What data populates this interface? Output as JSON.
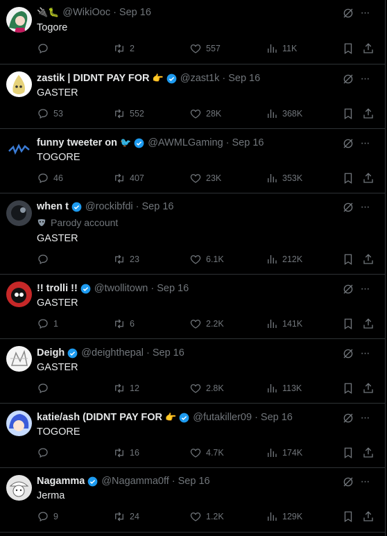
{
  "tweets": [
    {
      "name": "",
      "emoji": "🔌🐛",
      "verified": false,
      "handle": "@WikiOoc",
      "time": "Sep 16",
      "parody": "",
      "text": "Togore",
      "replies": "",
      "retweets": "2",
      "likes": "557",
      "views": "11K"
    },
    {
      "name": "zastik | DIDNT PAY FOR",
      "emoji": "👉",
      "verified": true,
      "handle": "@zast1k",
      "time": "Sep 16",
      "parody": "",
      "text": "GASTER",
      "replies": "53",
      "retweets": "552",
      "likes": "28K",
      "views": "368K"
    },
    {
      "name": "funny tweeter on",
      "emoji": "🐦",
      "verified": true,
      "handle": "@AWMLGaming",
      "time": "Sep 16",
      "parody": "",
      "text": "TOGORE",
      "replies": "46",
      "retweets": "407",
      "likes": "23K",
      "views": "353K"
    },
    {
      "name": "when t",
      "emoji": "",
      "verified": true,
      "handle": "@rockibfdi",
      "time": "Sep 16",
      "parody": "Parody account",
      "text": "GASTER",
      "replies": "",
      "retweets": "23",
      "likes": "6.1K",
      "views": "212K"
    },
    {
      "name": "!! trolli !!",
      "emoji": "",
      "verified": true,
      "handle": "@twollitown",
      "time": "Sep 16",
      "parody": "",
      "text": "GASTER",
      "replies": "1",
      "retweets": "6",
      "likes": "2.2K",
      "views": "141K"
    },
    {
      "name": "Deigh",
      "emoji": "",
      "verified": true,
      "handle": "@deighthepal",
      "time": "Sep 16",
      "parody": "",
      "text": "GASTER",
      "replies": "",
      "retweets": "12",
      "likes": "2.8K",
      "views": "113K"
    },
    {
      "name": "katie/ash (DIDNT PAY FOR",
      "emoji": "👉",
      "verified": true,
      "handle": "@futakiller09",
      "time": "Sep 16",
      "parody": "",
      "text": "TOGORE",
      "replies": "",
      "retweets": "16",
      "likes": "4.7K",
      "views": "174K"
    },
    {
      "name": "Nagamma",
      "emoji": "",
      "verified": true,
      "handle": "@Nagamma0ff",
      "time": "Sep 16",
      "parody": "",
      "text": "Jerma",
      "replies": "9",
      "retweets": "24",
      "likes": "1.2K",
      "views": "129K"
    }
  ],
  "ui": {
    "separator": "·",
    "more": "···"
  },
  "colors": {
    "background": "#000000",
    "text": "#e7e9ea",
    "muted": "#71767b",
    "verified": "#1d9bf0",
    "border": "#2f3336"
  },
  "icons": [
    "reply-icon",
    "retweet-icon",
    "like-icon",
    "views-icon",
    "bookmark-icon",
    "share-icon",
    "grok-icon",
    "more-icon",
    "verified-badge-icon"
  ]
}
